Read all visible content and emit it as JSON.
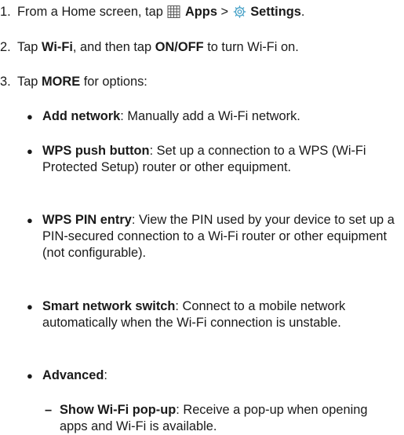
{
  "steps": [
    {
      "number": "1.",
      "pre": "From a Home screen, tap",
      "apps_icon": "apps-grid-icon",
      "apps_label": "Apps",
      "separator": ">",
      "settings_icon": "settings-gear-icon",
      "settings_label": "Settings",
      "end": "."
    },
    {
      "number": "2.",
      "pre": "Tap",
      "wifi_label": "Wi-Fi",
      "mid": ", and then tap",
      "onoff_label": "ON/OFF",
      "post": "to turn Wi-Fi on."
    },
    {
      "number": "3.",
      "pre": "Tap",
      "more_label": "MORE",
      "post": "for options:"
    }
  ],
  "options": [
    {
      "title": "Add network",
      "desc": ": Manually add a Wi-Fi network."
    },
    {
      "title": "WPS push button",
      "desc": ": Set up a connection to a WPS (Wi-Fi Protected Setup) router or other equipment."
    },
    {
      "title": "WPS PIN entry",
      "desc": ": View the PIN used by your device to set up a PIN-secured connection to a Wi-Fi router or other equipment (not configurable)."
    },
    {
      "title": "Smart network switch",
      "desc": ": Connect to a mobile network automatically when the Wi-Fi connection is unstable."
    },
    {
      "title": "Advanced",
      "desc": ":"
    }
  ],
  "advanced_options": [
    {
      "title": "Show Wi-Fi pop-up",
      "desc": ": Receive a pop-up when opening apps and Wi-Fi is available."
    }
  ],
  "colors": {
    "text": "#1a1a1a",
    "settings_icon": "#4aa3c8",
    "apps_icon": "#555555"
  }
}
